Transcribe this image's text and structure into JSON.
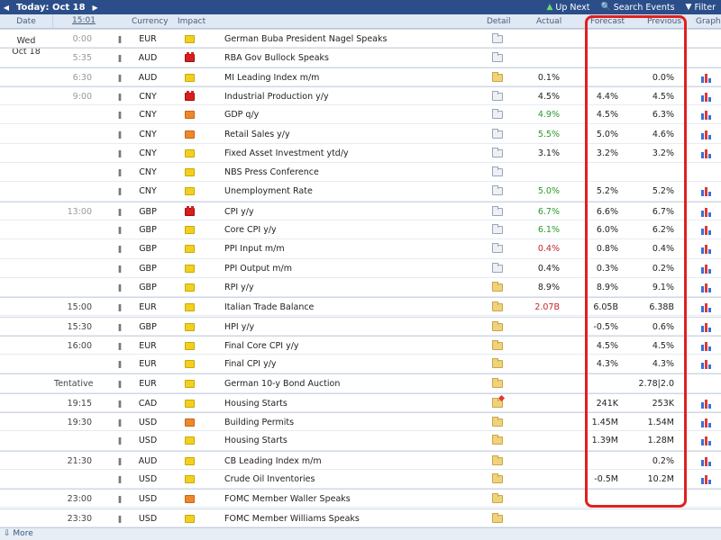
{
  "topbar": {
    "today_label": "Today: Oct 18",
    "prev_icon": "arrow-left-icon",
    "next_icon": "arrow-right-icon",
    "up_next_label": "Up Next",
    "search_label": "Search Events",
    "filter_label": "Filter"
  },
  "columns": {
    "date": "Date",
    "time": "15:01",
    "currency": "Currency",
    "impact": "Impact",
    "detail": "Detail",
    "actual": "Actual",
    "forecast": "Forecast",
    "previous": "Previous",
    "graph": "Graph"
  },
  "date_line1": "Wed",
  "date_line2": "Oct 18",
  "colors": {
    "topbar": "#2b4e8a",
    "better": "#2a9a2a",
    "worse": "#c0272d",
    "highlight": "#e02020"
  },
  "events": [
    {
      "time": "0:00",
      "currency": "EUR",
      "impact": "low",
      "event": "German Buba President Nagel Speaks",
      "detail": "hasdata",
      "actual": "",
      "actual_color": "",
      "forecast": "",
      "previous": "",
      "graph": false
    },
    {
      "time": "5:35",
      "currency": "AUD",
      "impact": "high",
      "event": "RBA Gov Bullock Speaks",
      "detail": "hasdata",
      "actual": "",
      "actual_color": "",
      "forecast": "",
      "previous": "",
      "graph": false
    },
    {
      "time": "6:30",
      "currency": "AUD",
      "impact": "low",
      "event": "MI Leading Index m/m",
      "detail": "plain",
      "actual": "0.1%",
      "actual_color": "",
      "forecast": "",
      "previous": "0.0%",
      "graph": true
    },
    {
      "time": "9:00",
      "currency": "CNY",
      "impact": "high",
      "event": "Industrial Production y/y",
      "detail": "hasdata",
      "actual": "4.5%",
      "actual_color": "",
      "forecast": "4.4%",
      "previous": "4.5%",
      "graph": true
    },
    {
      "time": "",
      "currency": "CNY",
      "impact": "med",
      "event": "GDP q/y",
      "detail": "hasdata",
      "actual": "4.9%",
      "actual_color": "green",
      "forecast": "4.5%",
      "previous": "6.3%",
      "graph": true
    },
    {
      "time": "",
      "currency": "CNY",
      "impact": "med",
      "event": "Retail Sales y/y",
      "detail": "hasdata",
      "actual": "5.5%",
      "actual_color": "green",
      "forecast": "5.0%",
      "previous": "4.6%",
      "graph": true
    },
    {
      "time": "",
      "currency": "CNY",
      "impact": "low",
      "event": "Fixed Asset Investment ytd/y",
      "detail": "hasdata",
      "actual": "3.1%",
      "actual_color": "",
      "forecast": "3.2%",
      "previous": "3.2%",
      "graph": true
    },
    {
      "time": "",
      "currency": "CNY",
      "impact": "low",
      "event": "NBS Press Conference",
      "detail": "hasdata",
      "actual": "",
      "actual_color": "",
      "forecast": "",
      "previous": "",
      "graph": false
    },
    {
      "time": "",
      "currency": "CNY",
      "impact": "low",
      "event": "Unemployment Rate",
      "detail": "hasdata",
      "actual": "5.0%",
      "actual_color": "green",
      "forecast": "5.2%",
      "previous": "5.2%",
      "graph": true
    },
    {
      "time": "13:00",
      "currency": "GBP",
      "impact": "high",
      "event": "CPI y/y",
      "detail": "hasdata",
      "actual": "6.7%",
      "actual_color": "green",
      "forecast": "6.6%",
      "previous": "6.7%",
      "graph": true
    },
    {
      "time": "",
      "currency": "GBP",
      "impact": "low",
      "event": "Core CPI y/y",
      "detail": "hasdata",
      "actual": "6.1%",
      "actual_color": "green",
      "forecast": "6.0%",
      "previous": "6.2%",
      "graph": true
    },
    {
      "time": "",
      "currency": "GBP",
      "impact": "low",
      "event": "PPI Input m/m",
      "detail": "hasdata",
      "actual": "0.4%",
      "actual_color": "red",
      "forecast": "0.8%",
      "previous": "0.4%",
      "graph": true
    },
    {
      "time": "",
      "currency": "GBP",
      "impact": "low",
      "event": "PPI Output m/m",
      "detail": "hasdata",
      "actual": "0.4%",
      "actual_color": "",
      "forecast": "0.3%",
      "previous": "0.2%",
      "graph": true
    },
    {
      "time": "",
      "currency": "GBP",
      "impact": "low",
      "event": "RPI y/y",
      "detail": "plain",
      "actual": "8.9%",
      "actual_color": "",
      "forecast": "8.9%",
      "previous": "9.1%",
      "graph": true
    },
    {
      "time": "15:00",
      "currency": "EUR",
      "impact": "low",
      "event": "Italian Trade Balance",
      "detail": "plain",
      "actual": "2.07B",
      "actual_color": "red",
      "forecast": "6.05B",
      "previous": "6.38B",
      "graph": true
    },
    {
      "time": "15:30",
      "currency": "GBP",
      "impact": "low",
      "event": "HPI y/y",
      "detail": "plain",
      "actual": "",
      "actual_color": "",
      "forecast": "-0.5%",
      "previous": "0.6%",
      "graph": true
    },
    {
      "time": "16:00",
      "currency": "EUR",
      "impact": "low",
      "event": "Final Core CPI y/y",
      "detail": "plain",
      "actual": "",
      "actual_color": "",
      "forecast": "4.5%",
      "previous": "4.5%",
      "graph": true
    },
    {
      "time": "",
      "currency": "EUR",
      "impact": "low",
      "event": "Final CPI y/y",
      "detail": "plain",
      "actual": "",
      "actual_color": "",
      "forecast": "4.3%",
      "previous": "4.3%",
      "graph": true
    },
    {
      "time": "Tentative",
      "currency": "EUR",
      "impact": "low",
      "event": "German 10-y Bond Auction",
      "detail": "plain",
      "actual": "",
      "actual_color": "",
      "forecast": "",
      "previous": "2.78|2.0",
      "graph": false
    },
    {
      "time": "19:15",
      "currency": "CAD",
      "impact": "low",
      "event": "Housing Starts",
      "detail": "star",
      "actual": "",
      "actual_color": "",
      "forecast": "241K",
      "previous": "253K",
      "graph": true
    },
    {
      "time": "19:30",
      "currency": "USD",
      "impact": "med",
      "event": "Building Permits",
      "detail": "plain",
      "actual": "",
      "actual_color": "",
      "forecast": "1.45M",
      "previous": "1.54M",
      "graph": true
    },
    {
      "time": "",
      "currency": "USD",
      "impact": "low",
      "event": "Housing Starts",
      "detail": "plain",
      "actual": "",
      "actual_color": "",
      "forecast": "1.39M",
      "previous": "1.28M",
      "graph": true
    },
    {
      "time": "21:30",
      "currency": "AUD",
      "impact": "low",
      "event": "CB Leading Index m/m",
      "detail": "plain",
      "actual": "",
      "actual_color": "",
      "forecast": "",
      "previous": "0.2%",
      "graph": true
    },
    {
      "time": "",
      "currency": "USD",
      "impact": "low",
      "event": "Crude Oil Inventories",
      "detail": "plain",
      "actual": "",
      "actual_color": "",
      "forecast": "-0.5M",
      "previous": "10.2M",
      "graph": true
    },
    {
      "time": "23:00",
      "currency": "USD",
      "impact": "med",
      "event": "FOMC Member Waller Speaks",
      "detail": "plain",
      "actual": "",
      "actual_color": "",
      "forecast": "",
      "previous": "",
      "graph": false
    },
    {
      "time": "23:30",
      "currency": "USD",
      "impact": "low",
      "event": "FOMC Member Williams Speaks",
      "detail": "plain",
      "actual": "",
      "actual_color": "",
      "forecast": "",
      "previous": "",
      "graph": false
    }
  ],
  "footer": {
    "more_label": "More",
    "more_icon": "chevron-down-icon"
  }
}
